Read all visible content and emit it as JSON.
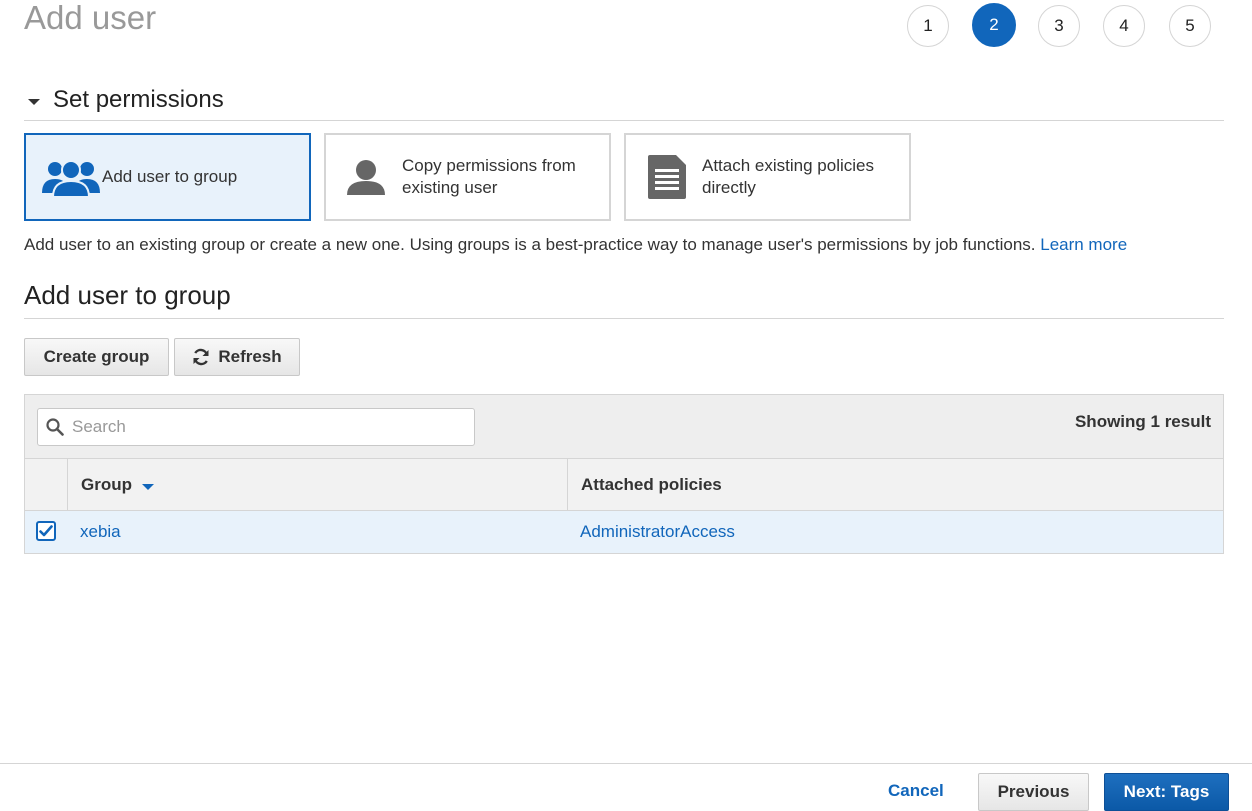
{
  "header": {
    "title": "Add user"
  },
  "steps": [
    {
      "label": "1",
      "active": false
    },
    {
      "label": "2",
      "active": true
    },
    {
      "label": "3",
      "active": false
    },
    {
      "label": "4",
      "active": false
    },
    {
      "label": "5",
      "active": false
    }
  ],
  "permissions": {
    "section_title": "Set permissions",
    "options": [
      {
        "label": "Add user to group",
        "icon": "group-icon",
        "selected": true
      },
      {
        "label_line1": "Copy permissions from",
        "label_line2": "existing user",
        "icon": "user-icon",
        "selected": false
      },
      {
        "label_line1": "Attach existing policies",
        "label_line2": "directly",
        "icon": "document-icon",
        "selected": false
      }
    ],
    "description": "Add user to an existing group or create a new one. Using groups is a best-practice way to manage user's permissions by job functions.",
    "learn_more": "Learn more"
  },
  "group_section": {
    "title": "Add user to group",
    "create_group_label": "Create group",
    "refresh_label": "Refresh",
    "refresh_icon": "refresh-icon",
    "search_placeholder": "Search",
    "search_icon": "search-icon",
    "showing": "Showing 1 result",
    "columns": {
      "group": "Group",
      "policies": "Attached policies"
    },
    "rows": [
      {
        "checked": true,
        "group": "xebia",
        "policies": "AdministratorAccess"
      }
    ]
  },
  "footer": {
    "cancel_label": "Cancel",
    "previous_label": "Previous",
    "next_label": "Next: Tags"
  },
  "colors": {
    "accent": "#1166bb",
    "selected_bg": "#e8f2fb",
    "title_gray": "#999999",
    "icon_gray": "#666666"
  }
}
